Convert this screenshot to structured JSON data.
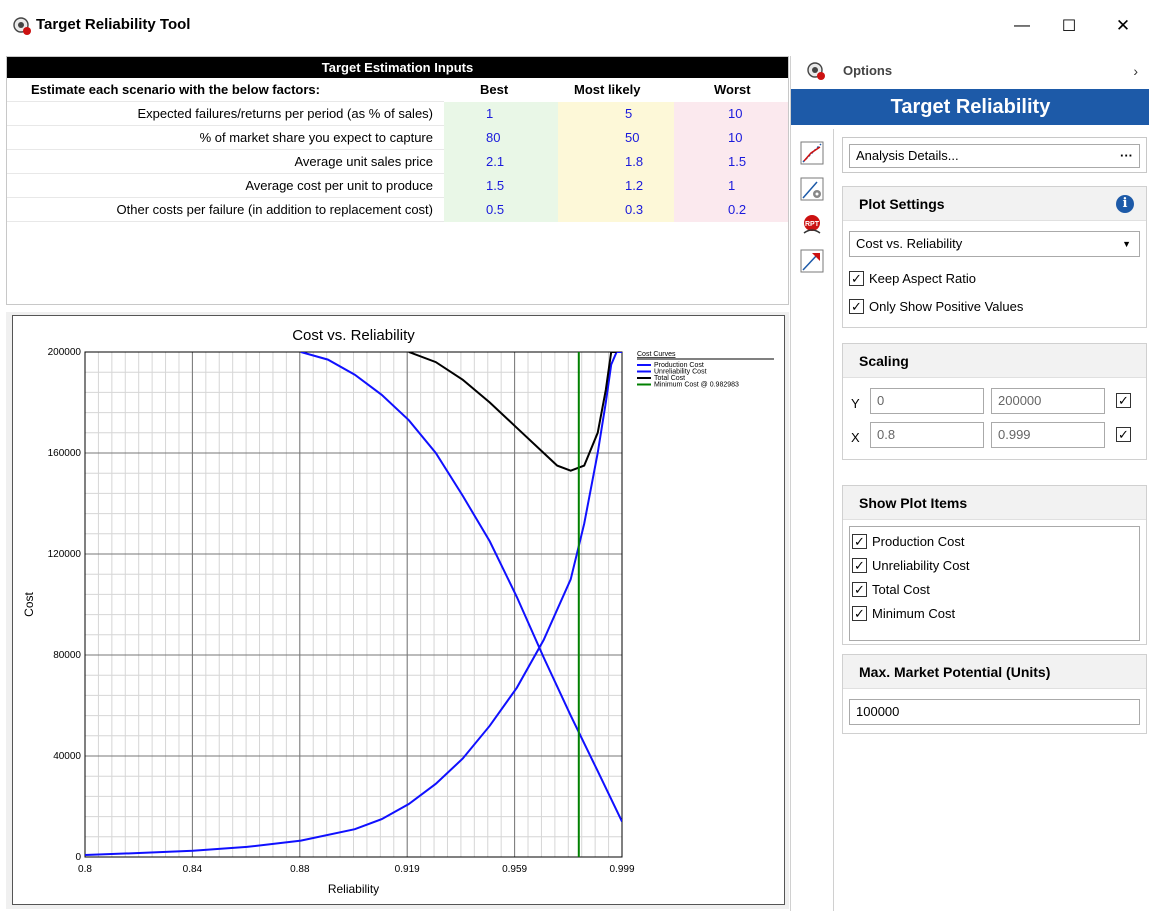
{
  "window": {
    "title": "Target Reliability Tool",
    "minimize": "—",
    "maximize": "☐",
    "close": "✕"
  },
  "inputs": {
    "header": "Target Estimation Inputs",
    "col_label": "Estimate each scenario with the below factors:",
    "col_best": "Best",
    "col_most_likely": "Most likely",
    "col_worst": "Worst",
    "rows": [
      {
        "label": "Expected failures/returns per period (as % of sales)",
        "best": "1",
        "most_likely": "5",
        "worst": "10"
      },
      {
        "label": "% of market share you expect to capture",
        "best": "80",
        "most_likely": "50",
        "worst": "10"
      },
      {
        "label": "Average unit sales price",
        "best": "2.1",
        "most_likely": "1.8",
        "worst": "1.5"
      },
      {
        "label": "Average cost per unit to produce",
        "best": "1.5",
        "most_likely": "1.2",
        "worst": "1"
      },
      {
        "label": "Other costs per failure (in addition to replacement cost)",
        "best": "0.5",
        "most_likely": "0.3",
        "worst": "0.2"
      }
    ]
  },
  "sidebar": {
    "options_label": "Options",
    "options_chevron": "›",
    "banner": "Target Reliability",
    "analysis_details": "Analysis Details...",
    "analysis_dots": "···",
    "plot_settings": {
      "title": "Plot Settings",
      "info": "i",
      "plot_type": "Cost vs. Reliability",
      "keep_aspect_ratio": "Keep Aspect Ratio",
      "only_positive": "Only Show Positive Values",
      "check_mark": "✓"
    },
    "scaling": {
      "title": "Scaling",
      "y_label": "Y",
      "x_label": "X",
      "y_min": "0",
      "y_max": "200000",
      "x_min": "0.8",
      "x_max": "0.999"
    },
    "show_plot_items": {
      "title": "Show Plot Items",
      "items": [
        "Production Cost",
        "Unreliability Cost",
        "Total Cost",
        "Minimum Cost"
      ]
    },
    "max_market": {
      "title": "Max. Market Potential (Units)",
      "value": "100000"
    }
  },
  "colors": {
    "banner": "#1d5aa8",
    "production": "#1010ff",
    "unreliability": "#1010ff",
    "total": "#000000",
    "minimum": "#008000"
  },
  "chart_data": {
    "type": "line",
    "title": "Cost vs. Reliability",
    "xlabel": "Reliability",
    "ylabel": "Cost",
    "xlim": [
      0.8,
      0.999
    ],
    "ylim": [
      0,
      200000
    ],
    "x_ticks": [
      "0.8",
      "0.84",
      "0.88",
      "0.919",
      "0.959",
      "0.999"
    ],
    "y_ticks": [
      "0",
      "40000",
      "80000",
      "120000",
      "160000",
      "200000"
    ],
    "grid": true,
    "legend_title": "Cost Curves",
    "legend_position": "top-right",
    "series": [
      {
        "name": "Production Cost",
        "color": "#1010ff",
        "x": [
          0.8,
          0.82,
          0.84,
          0.86,
          0.88,
          0.9,
          0.91,
          0.92,
          0.93,
          0.94,
          0.95,
          0.96,
          0.97,
          0.98,
          0.985,
          0.99,
          0.993,
          0.995,
          0.997,
          0.999
        ],
        "y": [
          800,
          1600,
          2500,
          4000,
          6500,
          11000,
          15000,
          21000,
          29000,
          39000,
          52000,
          67000,
          86000,
          110000,
          132000,
          160000,
          180000,
          195000,
          200000,
          200000
        ]
      },
      {
        "name": "Unreliability Cost",
        "color": "#1010ff",
        "x": [
          0.88,
          0.89,
          0.9,
          0.91,
          0.92,
          0.93,
          0.94,
          0.95,
          0.96,
          0.97,
          0.98,
          0.99,
          0.999
        ],
        "y": [
          200000,
          197000,
          191000,
          183000,
          173000,
          160000,
          143000,
          125000,
          103000,
          79000,
          56000,
          34000,
          14000
        ]
      },
      {
        "name": "Total Cost",
        "color": "#000000",
        "x": [
          0.92,
          0.93,
          0.94,
          0.95,
          0.96,
          0.97,
          0.975,
          0.98,
          0.985,
          0.99,
          0.993,
          0.995,
          0.997
        ],
        "y": [
          200000,
          196000,
          189000,
          180000,
          170000,
          160000,
          155000,
          153000,
          155000,
          168000,
          185000,
          200000,
          200000
        ]
      },
      {
        "name": "Minimum Cost @ 0.982983",
        "color": "#008000",
        "x": [
          0.982983,
          0.982983
        ],
        "y": [
          0,
          200000
        ]
      }
    ]
  }
}
